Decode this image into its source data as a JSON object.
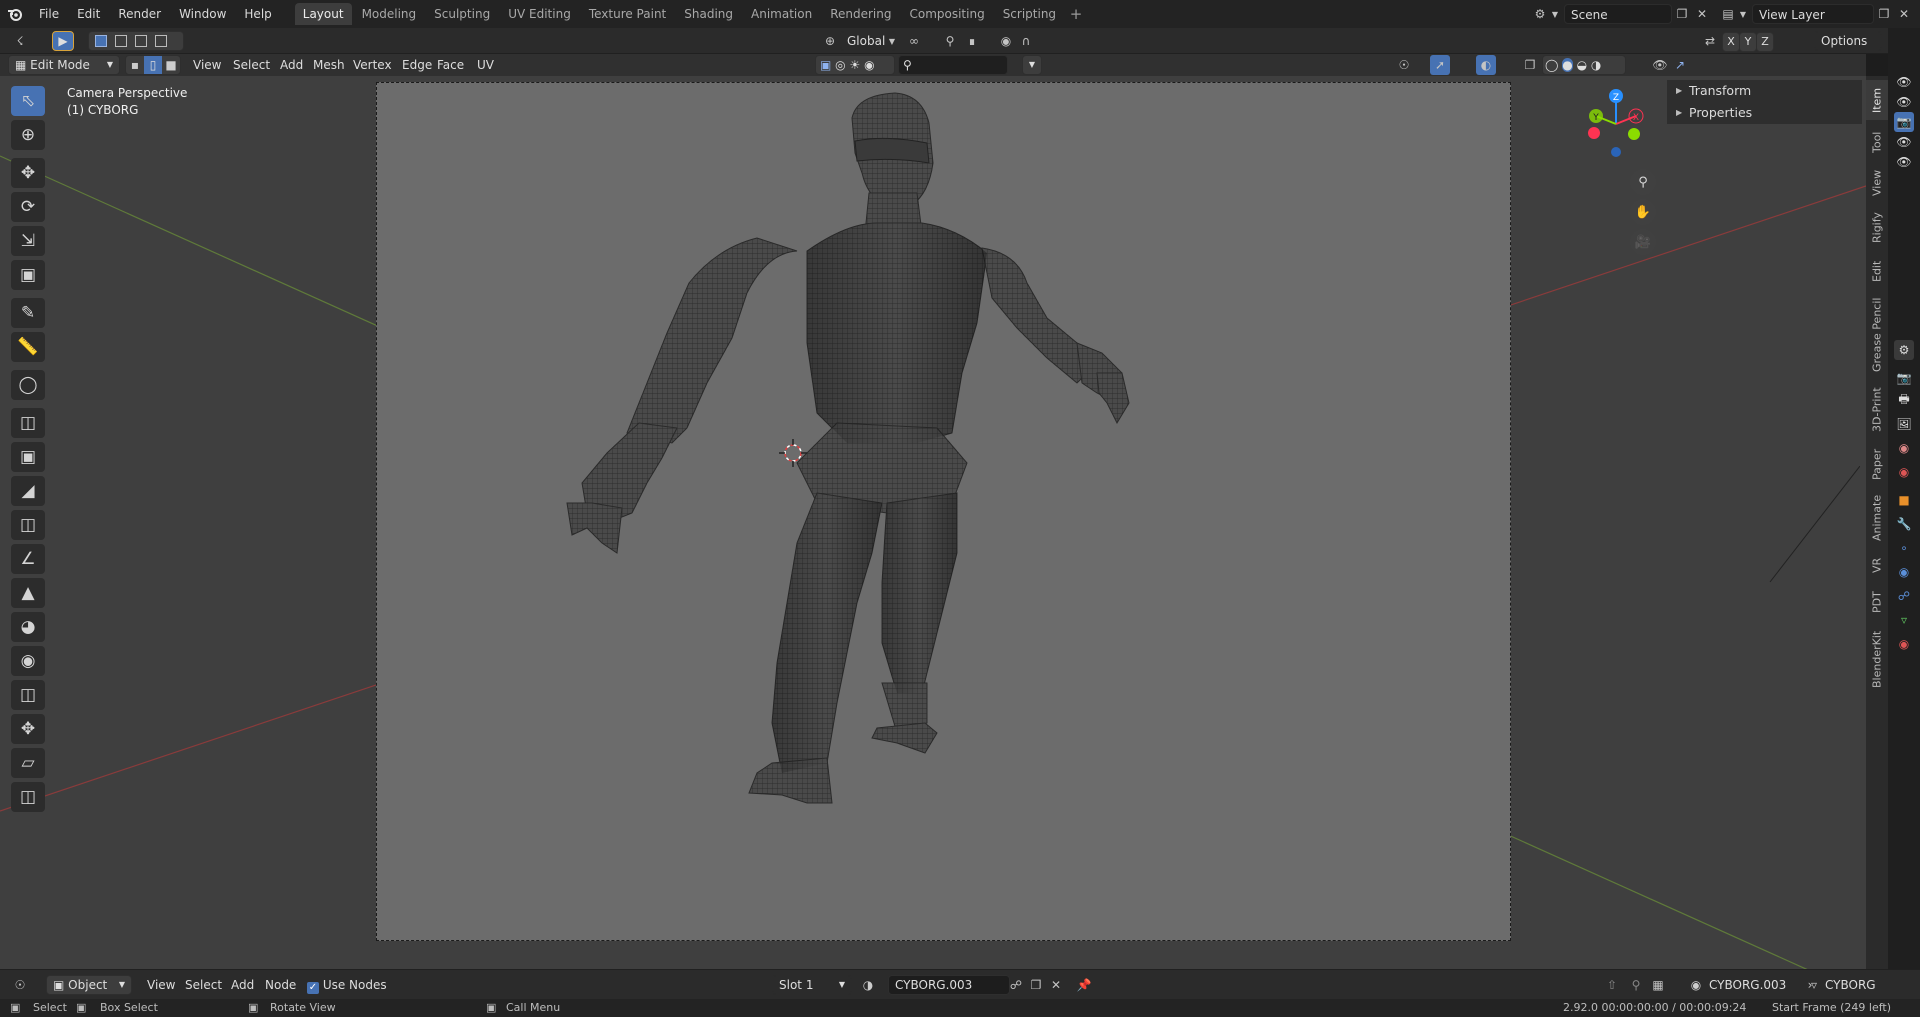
{
  "topbar": {
    "menus": [
      "File",
      "Edit",
      "Render",
      "Window",
      "Help"
    ],
    "workspaces": [
      "Layout",
      "Modeling",
      "Sculpting",
      "UV Editing",
      "Texture Paint",
      "Shading",
      "Animation",
      "Rendering",
      "Compositing",
      "Scripting"
    ],
    "active_workspace": "Layout",
    "scene": "Scene",
    "view_layer": "View Layer"
  },
  "header": {
    "transform_orientation": "Global",
    "axes": [
      "X",
      "Y",
      "Z"
    ],
    "options": "Options"
  },
  "viewport_header": {
    "mode": "Edit Mode",
    "menus": [
      "View",
      "Select",
      "Add",
      "Mesh",
      "Vertex",
      "Edge",
      "Face",
      "UV"
    ]
  },
  "viewport": {
    "view_name": "Camera Perspective",
    "object_name": "(1) CYBORG"
  },
  "gizmo": {
    "x": "X",
    "y": "Y",
    "z": "Z"
  },
  "npanel": {
    "sections": [
      "Transform",
      "Properties"
    ],
    "tabs": [
      "Item",
      "Tool",
      "View",
      "Rigify",
      "Edit",
      "Grease Pencil",
      "3D-Print",
      "Paper",
      "Animate",
      "VR",
      "PDT",
      "BlenderKit"
    ],
    "active_tab": "Item"
  },
  "node_editor_header": {
    "editor": "Object",
    "menus": [
      "View",
      "Select",
      "Add",
      "Node"
    ],
    "use_nodes_label": "Use Nodes",
    "use_nodes_checked": true,
    "slot": "Slot 1",
    "material": "CYBORG.003",
    "right_material": "CYBORG.003",
    "right_object": "CYBORG"
  },
  "statusbar": {
    "select": "Select",
    "box_select": "Box Select",
    "rotate_view": "Rotate View",
    "call_menu": "Call Menu",
    "version_time": "2.92.0  00:00:00:00 / 00:00:09:24",
    "frame_info": "Start Frame (249 left)"
  },
  "colors": {
    "accent": "#4772b3",
    "x_axis": "#ff3352",
    "y_axis": "#8bdc00",
    "z_axis": "#2890ff",
    "viewport_bg": "#3f3f3f",
    "camera_bg": "#6c6c6c"
  },
  "icons": {
    "tools": [
      "select-box-icon",
      "cursor-icon",
      "move-icon",
      "rotate-icon",
      "scale-icon",
      "transform-icon",
      "annotate-icon",
      "measure-icon",
      "add-cube-icon",
      "extrude-icon",
      "inset-icon",
      "bevel-icon",
      "loop-cut-icon",
      "knife-icon",
      "poly-build-icon",
      "spin-icon",
      "smooth-icon",
      "edge-slide-icon",
      "shrink-fatten-icon",
      "shear-icon",
      "rip-icon"
    ]
  }
}
